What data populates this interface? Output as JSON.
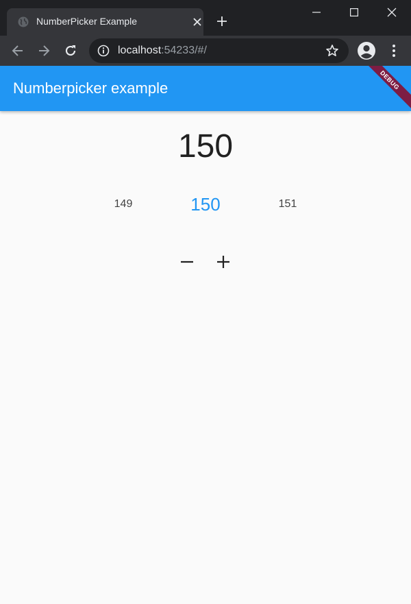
{
  "browser": {
    "tab_title": "NumberPicker Example",
    "url_host": "localhost",
    "url_rest": ":54233/#/"
  },
  "app": {
    "appbar_title": "Numberpicker example",
    "debug_label": "DEBUG",
    "current_value": "150",
    "picker": {
      "previous": "149",
      "selected": "150",
      "next": "151"
    },
    "colors": {
      "primary": "#2196f3",
      "debug_banner": "#7d1d44"
    }
  },
  "icons": {
    "favicon": "globe-icon",
    "tab_close": "close-icon",
    "new_tab": "plus-icon",
    "minimize": "minimize-icon",
    "maximize": "maximize-icon",
    "close_window": "close-icon",
    "back": "arrow-left-icon",
    "forward": "arrow-right-icon",
    "reload": "reload-icon",
    "info": "info-icon",
    "bookmark": "star-icon",
    "profile": "account-icon",
    "menu": "kebab-icon",
    "decrement": "minus-icon",
    "increment": "plus-icon"
  }
}
